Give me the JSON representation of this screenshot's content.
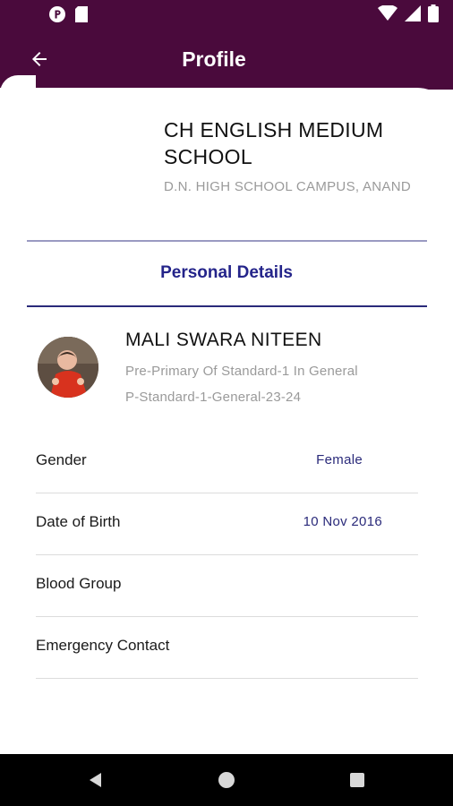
{
  "header": {
    "title": "Profile",
    "background_color": "#4a0a3c"
  },
  "school": {
    "name": "CH ENGLISH MEDIUM SCHOOL",
    "address": "D.N. HIGH SCHOOL CAMPUS, ANAND"
  },
  "section": {
    "title": "Personal Details"
  },
  "student": {
    "name": "MALI SWARA NITEEN",
    "class": "Pre-Primary Of Standard-1 In General",
    "division": "P-Standard-1-General-23-24"
  },
  "details": [
    {
      "label": "Gender",
      "value": "Female"
    },
    {
      "label": "Date of Birth",
      "value": "10 Nov 2016"
    },
    {
      "label": "Blood Group",
      "value": ""
    },
    {
      "label": "Emergency Contact",
      "value": ""
    }
  ],
  "icons": {
    "back": "arrow-left-icon",
    "status_left": [
      "notification-p-icon",
      "sd-card-icon"
    ],
    "status_right": [
      "wifi-icon",
      "signal-icon",
      "battery-icon"
    ],
    "nav": [
      "back-triangle-icon",
      "home-circle-icon",
      "recents-square-icon"
    ]
  },
  "colors": {
    "accent": "#24248a",
    "value_text": "#2a2a7a"
  }
}
